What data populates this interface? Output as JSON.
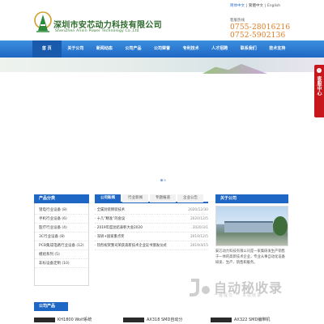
{
  "header": {
    "company_cn": "深圳市安芯动力科技有限公司",
    "company_en": "ShenZhen Anxin Power Technology Co.,Ltd",
    "langs": [
      "简体中文",
      "繁體中文",
      "English"
    ],
    "hotline_label": "客服热线",
    "phone1": "0755-28016216",
    "phone2": "0752-5902136"
  },
  "nav": {
    "items": [
      "首 页",
      "关于公司",
      "新闻动态",
      "公司产品",
      "公司荣誉",
      "专利技术",
      "人才招聘",
      "联系我们",
      "技术支持"
    ]
  },
  "float_service": {
    "label": "客服中心"
  },
  "categories": {
    "title": "产品分类",
    "items": [
      "锂电行业设备 (8)",
      "手机行业设备 (6)",
      "医疗行业设备 (4)",
      "3C行业设备 (8)",
      "PCB集成电路行业设备 (12)",
      "模组系列 (5)",
      "非标设备定制 (10)"
    ]
  },
  "news": {
    "tabs": [
      "公司新闻",
      "行业新闻",
      "专题报道",
      "企业公告"
    ],
    "items": [
      {
        "title": "· 全属封装倒装技术",
        "date": "2020/12/30"
      },
      {
        "title": "· 十几“精准”的会议",
        "date": "2020/12/5"
      },
      {
        "title": "· 2019年度总结表彰大会2020",
        "date": "2020/3/1"
      },
      {
        "title": "· 深圳+国家重点奖",
        "date": "2019/12/5"
      },
      {
        "title": "· 热烈祝贺我司荣获高新技术企业证书颁发仪式",
        "date": "2019/4/15"
      }
    ]
  },
  "about": {
    "title": "关于公司",
    "text": "安芯动力科技有限公司是一家集研发生产销售于一体的高新技术企业，专业从事自动化设备研发、生产、销售和服务。"
  },
  "products": {
    "title": "公司产品",
    "items": [
      "KH1800 Wolf系统",
      "AX318 SMD自动分",
      "AX322 SMD编带机"
    ]
  },
  "watermark": {
    "text": "自动秘收录",
    "sub": "一键提交 一 本站收录"
  }
}
